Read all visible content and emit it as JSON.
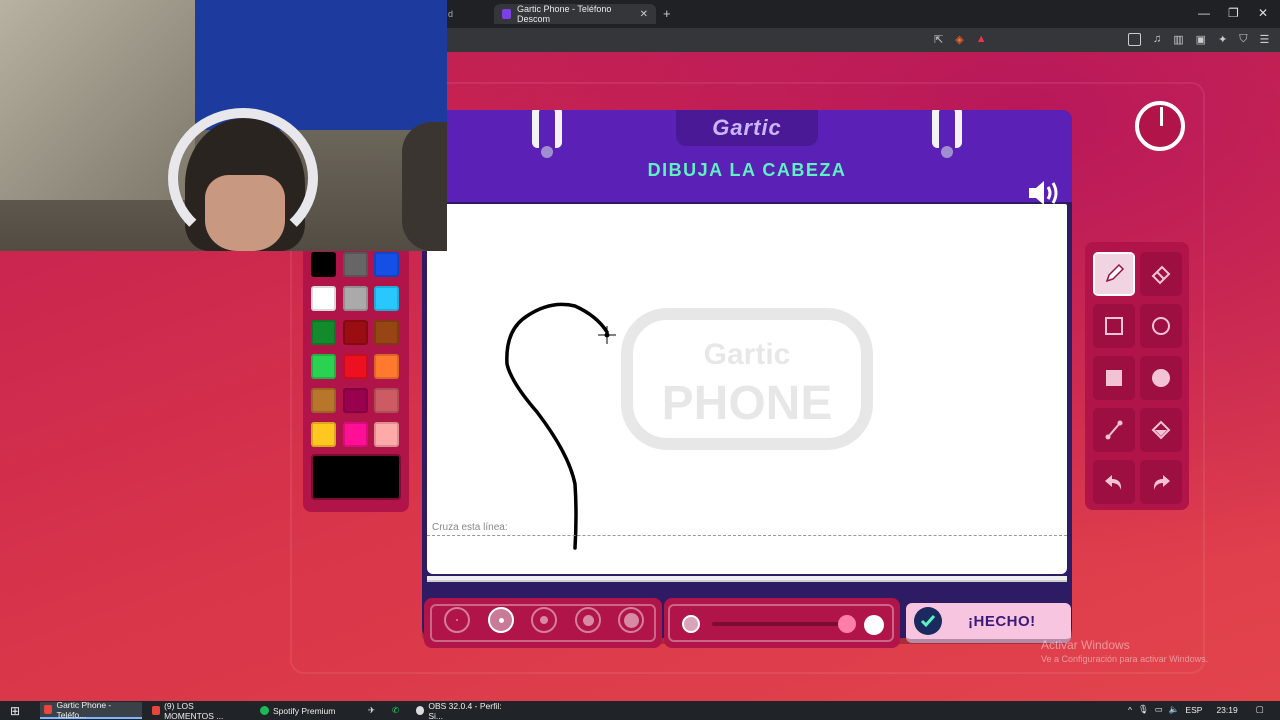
{
  "browser": {
    "tabs": [
      {
        "label": "d",
        "active": false
      },
      {
        "label": "Gartic Phone - Teléfono Descom",
        "active": true
      }
    ],
    "new_tab": "+",
    "window_controls": [
      "—",
      "❐",
      "✕"
    ]
  },
  "game": {
    "logo": "Gartic",
    "prompt": "DIBUJA LA CABEZA",
    "cross_line_label": "Cruza esta línea:",
    "done_button": "¡HECHO!",
    "palette_colors": [
      "#000000",
      "#666666",
      "#1450e6",
      "#ffffff",
      "#aaaaaa",
      "#28c8ff",
      "#138a2c",
      "#9a0d12",
      "#974515",
      "#2bd151",
      "#ec1020",
      "#ff7a2e",
      "#b8762b",
      "#99004e",
      "#cc5b63",
      "#ffc71f",
      "#ff0f96",
      "#ffaaa8"
    ],
    "selected_color": "#000000",
    "tools": [
      "pencil-tool",
      "eraser-tool",
      "rectangle-outline-tool",
      "circle-outline-tool",
      "rectangle-fill-tool",
      "circle-fill-tool",
      "line-tool",
      "bucket-tool",
      "undo-tool",
      "redo-tool"
    ],
    "active_tool": "pencil-tool",
    "brush_sizes": [
      1,
      2,
      3,
      4,
      5
    ],
    "selected_brush_size": 2,
    "opacity_level": 0.9
  },
  "windows_watermark": {
    "title": "Activar Windows",
    "subtitle": "Ve a Configuración para activar Windows."
  },
  "taskbar": {
    "items": [
      {
        "label": "Gartic Phone - Teléfo...",
        "active": true
      },
      {
        "label": "(9) LOS MOMENTOS ...",
        "active": false
      },
      {
        "label": "Spotify Premium",
        "active": false
      },
      {
        "label": "OBS 32.0.4 - Perfil: Si...",
        "active": false
      }
    ],
    "language": "ESP",
    "time": "23:19"
  }
}
